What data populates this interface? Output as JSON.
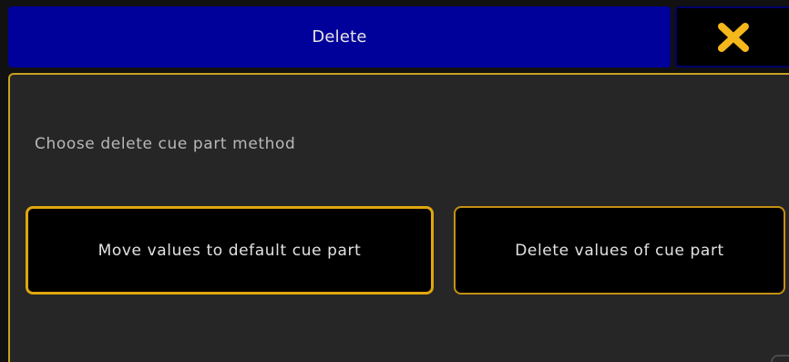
{
  "dialog": {
    "title": "Delete",
    "close_icon": "close-x-icon",
    "prompt": "Choose delete cue part method",
    "options": [
      {
        "label": "Move values to default cue part",
        "selected": true
      },
      {
        "label": "Delete values of cue part",
        "selected": false
      }
    ]
  },
  "colors": {
    "title_bar": "#00009a",
    "accent_border": "#c9a021",
    "selected_border": "#e0a60f",
    "close_icon": "#f5b81c",
    "panel_background": "#262626"
  }
}
